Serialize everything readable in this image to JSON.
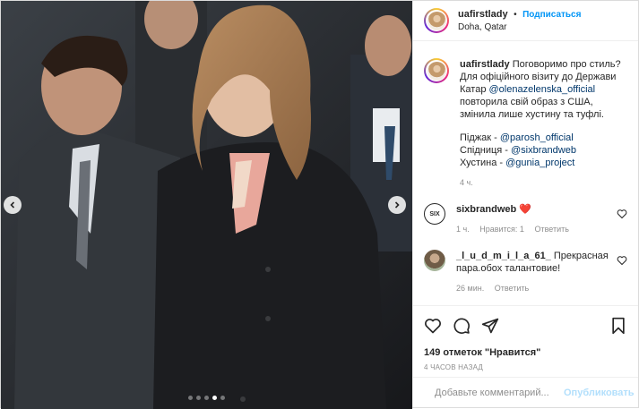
{
  "post": {
    "user": "uafirstlady",
    "dot": "•",
    "follow_label": "Подписаться",
    "location": "Doha, Qatar",
    "caption": {
      "user": "uafirstlady",
      "text_1": "Поговоримо про стиль? Для офіційного візиту до Держави Катар ",
      "mention_1": "@olenazelenska_official",
      "text_2": " повторила свій образ з США, змінила лише хустину та туфлі.",
      "line_1_label": "Піджак - ",
      "line_1_link": "@parosh_official",
      "line_2_label": "Спідниця - ",
      "line_2_link": "@sixbrandweb",
      "line_3_label": "Хустина - ",
      "line_3_link": "@gunia_project",
      "time": "4 ч."
    },
    "comments": [
      {
        "user": "sixbrandweb",
        "avatar_text": "SIX",
        "text": "",
        "emoji": "❤️",
        "time": "1 ч.",
        "likes": "Нравится: 1",
        "reply": "Ответить"
      },
      {
        "user": "_l_u_d_m_i_l_a_61_",
        "text": "Прекрасная пара.обох талантовие!",
        "time": "26 мин.",
        "reply": "Ответить"
      }
    ],
    "likes": "149 отметок \"Нравится\"",
    "time_ago": "4 ЧАСОВ НАЗАД",
    "add_comment_placeholder": "Добавьте комментарий...",
    "publish_label": "Опубликовать",
    "carousel": {
      "count": 5,
      "active": 3
    }
  },
  "colors": {
    "accent": "#0095f6",
    "link": "#00376b",
    "like": "#ed4956",
    "muted": "#8e8e8e"
  }
}
